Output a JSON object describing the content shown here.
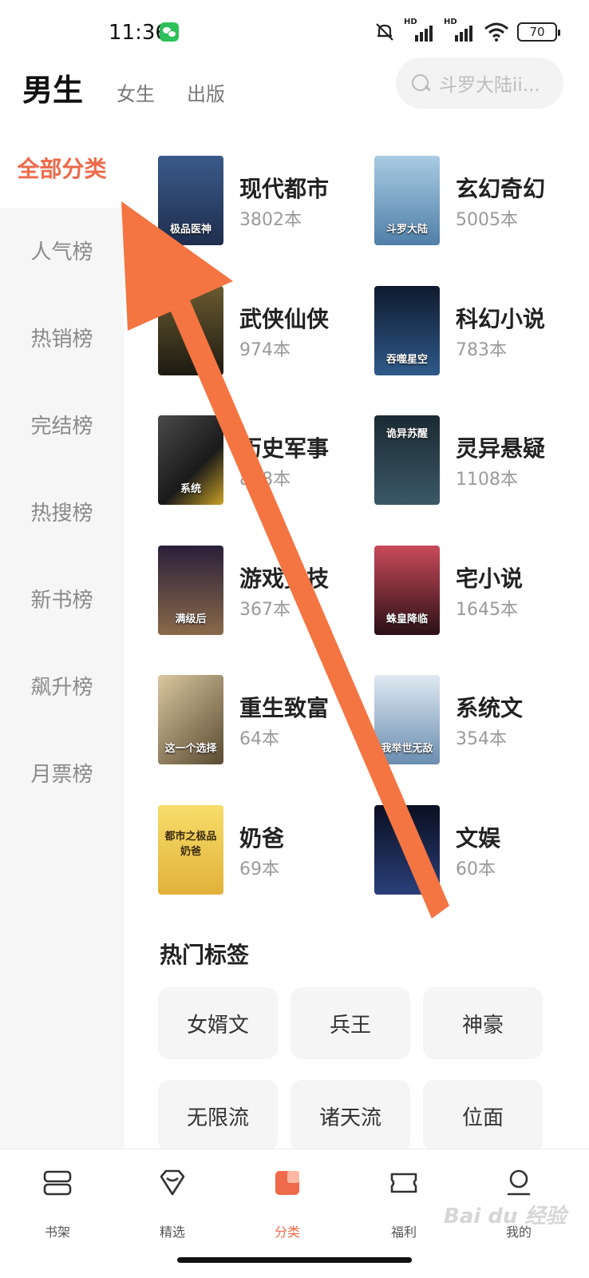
{
  "status": {
    "time": "11:36",
    "battery": "70",
    "hd1": "HD",
    "hd2": "HD"
  },
  "header": {
    "tab_active": "男生",
    "tabs": [
      "女生",
      "出版"
    ],
    "search_placeholder": "斗罗大陆ii..."
  },
  "sidebar": {
    "items": [
      {
        "label": "全部分类",
        "active": true
      },
      {
        "label": "人气榜"
      },
      {
        "label": "热销榜"
      },
      {
        "label": "完结榜"
      },
      {
        "label": "热搜榜"
      },
      {
        "label": "新书榜"
      },
      {
        "label": "飙升榜"
      },
      {
        "label": "月票榜"
      }
    ]
  },
  "categories": [
    {
      "name": "现代都市",
      "count": "3802本",
      "cover_text": "极品医神",
      "color": "#1f2e4d"
    },
    {
      "name": "玄幻奇幻",
      "count": "5005本",
      "cover_text": "斗罗大陆",
      "color": "#6ea2c9"
    },
    {
      "name": "武侠仙侠",
      "count": "974本",
      "cover_text": "",
      "color": "#3a3320"
    },
    {
      "name": "科幻小说",
      "count": "783本",
      "cover_text": "吞噬星空",
      "color": "#1d3050"
    },
    {
      "name": "历史军事",
      "count": "838本",
      "cover_text": "系统",
      "color": "#2b2b2b"
    },
    {
      "name": "灵异悬疑",
      "count": "1108本",
      "cover_text": "诡异苏醒",
      "color": "#233a46"
    },
    {
      "name": "游戏竞技",
      "count": "367本",
      "cover_text": "满级后",
      "color": "#3b2e45"
    },
    {
      "name": "宅小说",
      "count": "1645本",
      "cover_text": "蛛皇降临",
      "color": "#5a2230"
    },
    {
      "name": "重生致富",
      "count": "64本",
      "cover_text": "这一个选择",
      "color": "#807055"
    },
    {
      "name": "系统文",
      "count": "354本",
      "cover_text": "我举世无敌",
      "color": "#6f8fb0"
    },
    {
      "name": "奶爸",
      "count": "69本",
      "cover_text": "都市之极品奶爸",
      "color": "#e9c24a"
    },
    {
      "name": "文娱",
      "count": "60本",
      "cover_text": "",
      "color": "#141c33"
    }
  ],
  "hot_tags": {
    "title": "热门标签",
    "tags": [
      "女婿文",
      "兵王",
      "神豪",
      "无限流",
      "诸天流",
      "位面"
    ]
  },
  "bottom_nav": {
    "items": [
      {
        "label": "书架",
        "icon": "bookshelf-icon"
      },
      {
        "label": "精选",
        "icon": "featured-icon"
      },
      {
        "label": "分类",
        "icon": "category-icon",
        "active": true
      },
      {
        "label": "福利",
        "icon": "ticket-icon"
      },
      {
        "label": "我的",
        "icon": "profile-icon"
      }
    ]
  },
  "colors": {
    "accent": "#ef6a4a",
    "arrow": "#f47542"
  },
  "watermark": "Bai du 经验"
}
